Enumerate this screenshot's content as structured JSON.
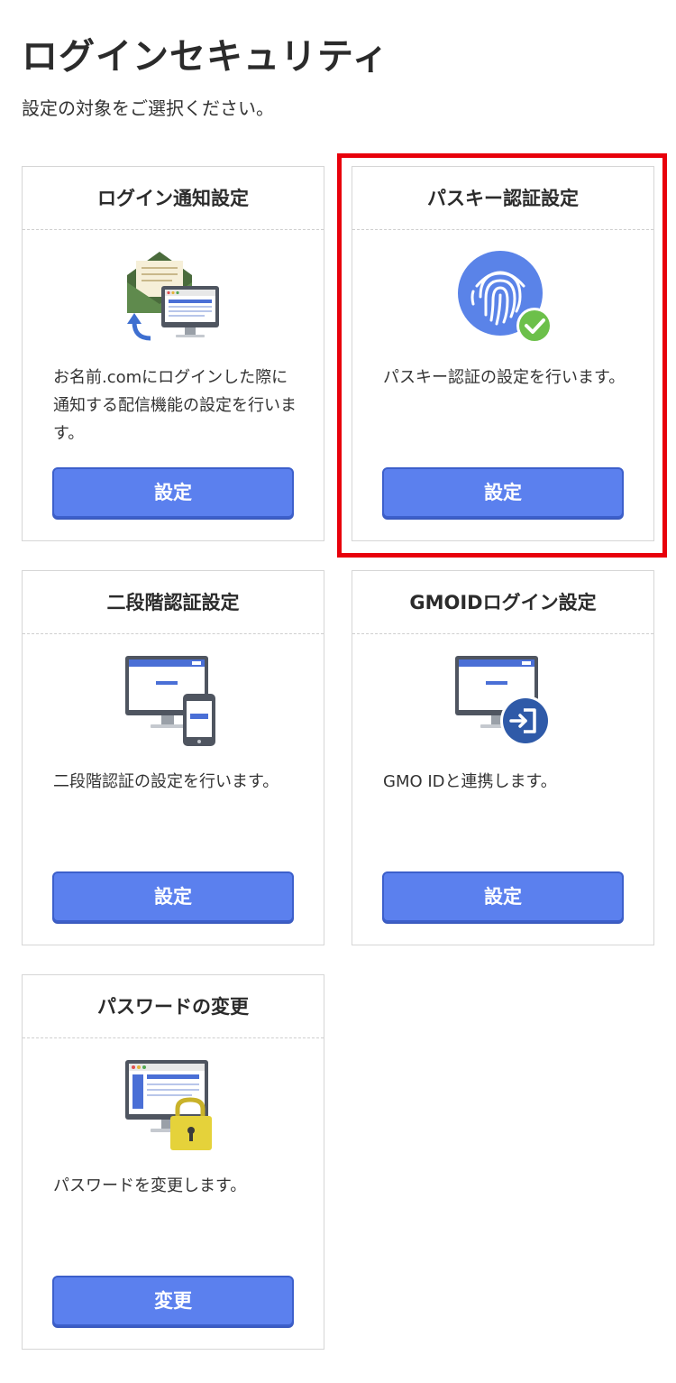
{
  "page": {
    "title": "ログインセキュリティ",
    "subtitle": "設定の対象をご選択ください。"
  },
  "colors": {
    "button": "#5b80ee",
    "highlight": "#e8000b"
  },
  "cards": [
    {
      "id": "login-notice",
      "title": "ログイン通知設定",
      "icon": "mail-monitor-icon",
      "description": "お名前.comにログインした際に通知する配信機能の設定を行います。",
      "button": "設定"
    },
    {
      "id": "passkey",
      "title": "パスキー認証設定",
      "icon": "fingerprint-check-icon",
      "description": "パスキー認証の設定を行います。",
      "button": "設定"
    },
    {
      "id": "two-factor",
      "title": "二段階認証設定",
      "icon": "monitor-phone-icon",
      "description": "二段階認証の設定を行います。",
      "button": "設定"
    },
    {
      "id": "gmoid",
      "title": "GMOIDログイン設定",
      "icon": "monitor-login-icon",
      "description": "GMO IDと連携します。",
      "button": "設定"
    },
    {
      "id": "password",
      "title": "パスワードの変更",
      "icon": "monitor-lock-icon",
      "description": "パスワードを変更します。",
      "button": "変更"
    }
  ]
}
